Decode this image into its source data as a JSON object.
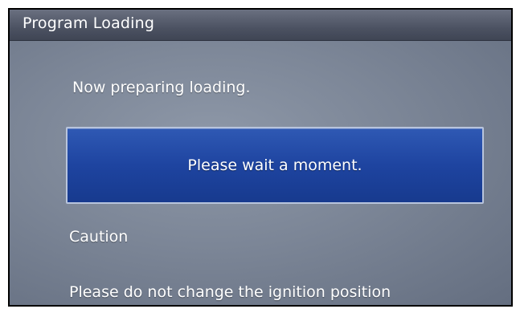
{
  "window": {
    "title": "Program Loading"
  },
  "messages": {
    "status": "Now preparing loading.",
    "wait": "Please wait a moment.",
    "caution_heading": "Caution",
    "caution_text": "Please do not change the ignition position"
  },
  "colors": {
    "panel_background": "#7c8697",
    "title_bar": "#4c5262",
    "wait_box": "#1e44a0",
    "wait_box_border": "#b8c4dc",
    "text": "#ffffff"
  }
}
